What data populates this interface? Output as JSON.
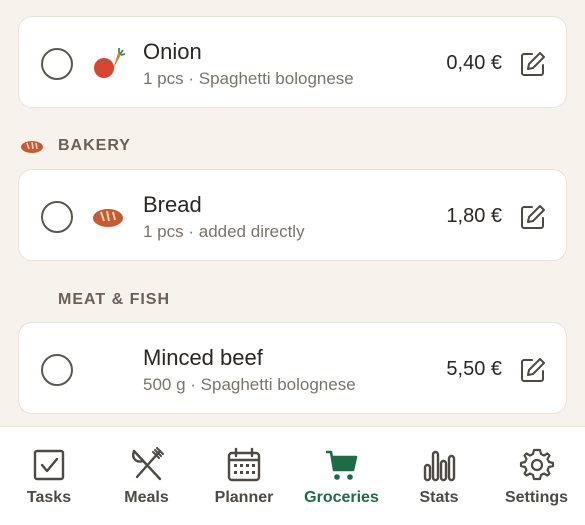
{
  "sections": [
    {
      "label": "BAKERY",
      "icon": "bread-icon"
    },
    {
      "label": "MEAT & FISH",
      "icon": ""
    }
  ],
  "items": [
    {
      "name": "Onion",
      "meta": "1 pcs · Spaghetti bolognese",
      "price": "0,40 €",
      "icon": "vegetables-icon",
      "checked": false
    },
    {
      "name": "Bread",
      "meta": "1 pcs · added directly",
      "price": "1,80 €",
      "icon": "bread-icon",
      "checked": false
    },
    {
      "name": "Minced beef",
      "meta": "500 g · Spaghetti bolognese",
      "price": "5,50 €",
      "icon": "",
      "checked": false
    }
  ],
  "nav": {
    "items": [
      {
        "label": "Tasks",
        "icon": "checkbox-icon"
      },
      {
        "label": "Meals",
        "icon": "fork-knife-icon"
      },
      {
        "label": "Planner",
        "icon": "calendar-icon"
      },
      {
        "label": "Groceries",
        "icon": "cart-icon",
        "active": true
      },
      {
        "label": "Stats",
        "icon": "bar-chart-icon"
      },
      {
        "label": "Settings",
        "icon": "gear-icon"
      }
    ]
  },
  "colors": {
    "background": "#f7f3ec",
    "card": "#ffffff",
    "accent": "#1f6b45",
    "section_text": "#6d5f55",
    "bread": "#c85a32"
  }
}
